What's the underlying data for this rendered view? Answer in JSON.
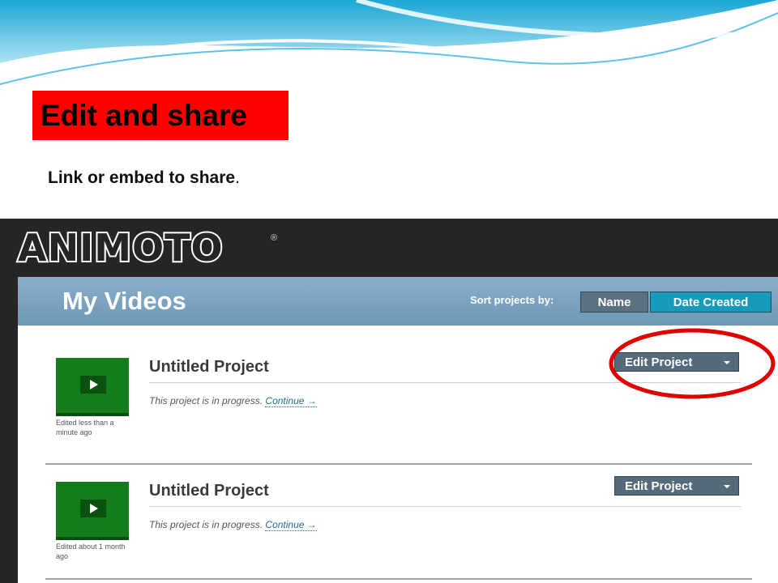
{
  "slide": {
    "title": "Edit and share",
    "subtitle": "Link or embed to share",
    "subtitle_end": ".",
    "title_bg": "#ff0000"
  },
  "app": {
    "logo": "ANIMOTO",
    "logo_mark": "®",
    "page_title": "My Videos",
    "sort_label": "Sort projects by:",
    "sort_options": [
      "Name",
      "Date Created"
    ],
    "selected_sort": "Date Created",
    "header_color": "#7ea6c2",
    "accent_color": "#169bbd"
  },
  "projects": [
    {
      "title": "Untitled Project",
      "status": "This project is in progress.",
      "continue_label": "Continue →",
      "edited": "Edited less than a minute ago",
      "edit_label": "Edit Project"
    },
    {
      "title": "Untitled Project",
      "status": "This project is in progress.",
      "continue_label": "Continue →",
      "edited": "Edited about 1 month ago",
      "edit_label": "Edit Project"
    }
  ],
  "icons": {
    "play": "play-icon",
    "caret": "chevron-down-icon"
  },
  "annotation_color": "#e00000"
}
